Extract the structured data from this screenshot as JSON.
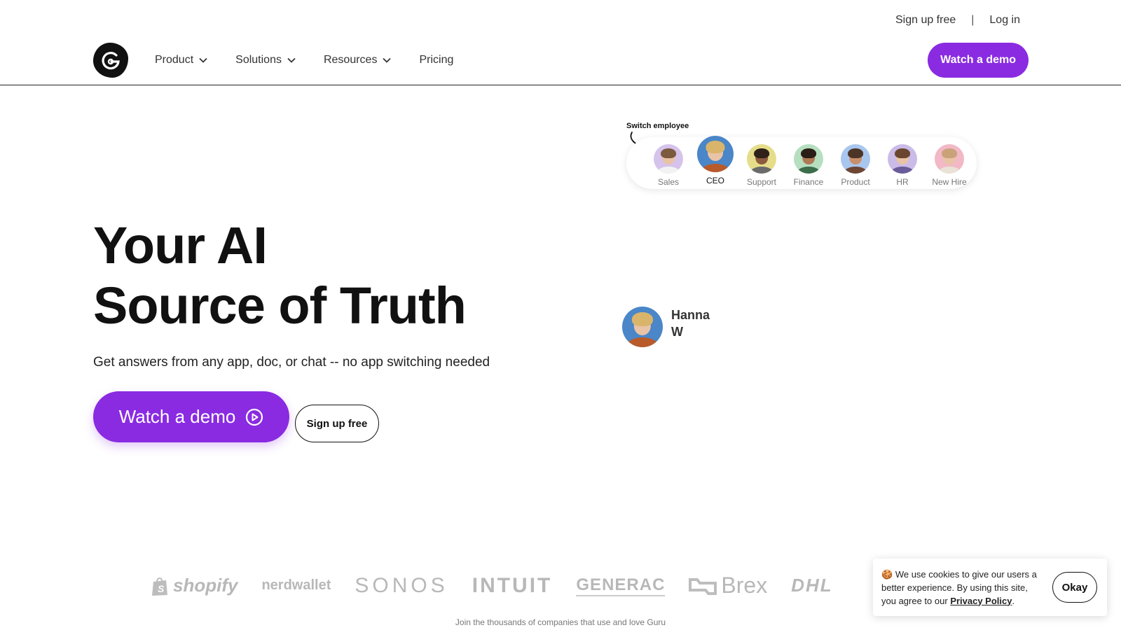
{
  "header": {
    "utility": {
      "signup": "Sign up free",
      "separator": "|",
      "login": "Log in"
    },
    "nav": [
      {
        "label": "Product",
        "has_dropdown": true
      },
      {
        "label": "Solutions",
        "has_dropdown": true
      },
      {
        "label": "Resources",
        "has_dropdown": true
      },
      {
        "label": "Pricing",
        "has_dropdown": false
      }
    ],
    "cta": "Watch a demo",
    "logo_icon": "guru-logo-icon"
  },
  "hero": {
    "title_line1": "Your AI",
    "title_line2": "Source of Truth",
    "subtitle": "Get answers from any app, doc, or chat -- no app switching needed",
    "primary_cta": "Watch a demo",
    "secondary_cta": "Sign up free"
  },
  "switcher": {
    "label": "Switch employee",
    "employees": [
      {
        "label": "Sales",
        "active": false
      },
      {
        "label": "CEO",
        "active": true
      },
      {
        "label": "Support",
        "active": false
      },
      {
        "label": "Finance",
        "active": false
      },
      {
        "label": "Product",
        "active": false
      },
      {
        "label": "HR",
        "active": false
      },
      {
        "label": "New Hire",
        "active": false
      }
    ]
  },
  "chat_user": {
    "name": "Hanna W"
  },
  "logos": {
    "items": [
      "shopify",
      "nerdwallet",
      "SONOS",
      "INTUIT",
      "GENERAC",
      "Brex",
      "DHL"
    ],
    "caption": "Join the thousands of companies that use and love Guru"
  },
  "cookie": {
    "text": "We use cookies to give our users a better experience.  By using this site, you agree to our",
    "link": "Privacy Policy",
    "end": ".",
    "button": "Okay"
  },
  "colors": {
    "accent": "#8a2be2",
    "text": "#111111",
    "muted": "#b8b8b8"
  }
}
